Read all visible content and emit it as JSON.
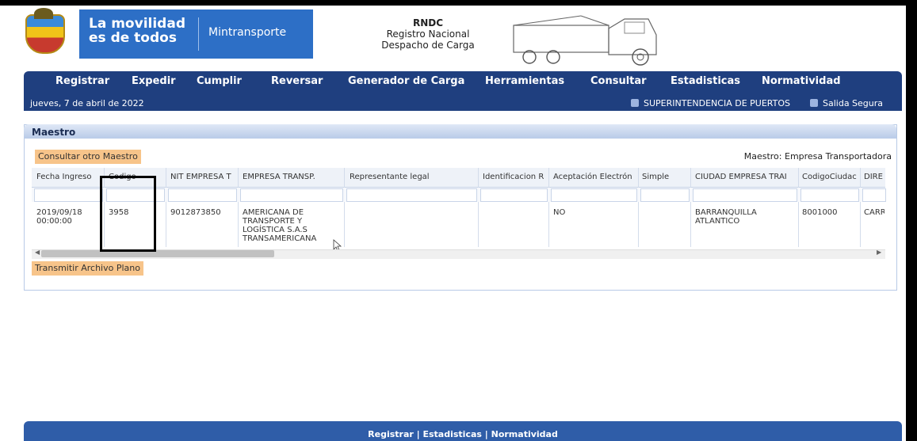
{
  "header": {
    "slogan_line1": "La movilidad",
    "slogan_line2": "es de todos",
    "ministry": "Mintransporte",
    "rndc_title": "RNDC",
    "rndc_line2": "Registro   Nacional",
    "rndc_line3": "Despacho de Carga",
    "brand_blue": "#2d6fc6"
  },
  "nav": {
    "items": [
      "Registrar",
      "Expedir",
      "Cumplir",
      "Reversar",
      "Generador de Carga",
      "Herramientas",
      "Consultar",
      "Estadisticas",
      "Normatividad"
    ],
    "bg_color": "#1f3f7f"
  },
  "subbar": {
    "date": "jueves, 7 de abril de 2022",
    "link_ports": "SUPERINTENDENCIA DE PUERTOS",
    "link_exit": "Salida Segura"
  },
  "panel": {
    "title": "Maestro",
    "consult_button": "Consultar otro Maestro",
    "maestro_label": "Maestro: Empresa Transportadora",
    "transmit_button": "Transmitir Archivo Plano",
    "button_color": "#f7c48a"
  },
  "table": {
    "columns": [
      "Fecha Ingreso",
      "Codigo",
      "NIT EMPRESA T",
      "EMPRESA TRANSP.",
      "Representante legal",
      "Identificacion R",
      "Aceptación Electrón",
      "Simple",
      "CIUDAD EMPRESA TRAI",
      "CodigoCiudac",
      "DIRE"
    ],
    "row": {
      "fecha": "2019/09/18",
      "hora": "00:00:00",
      "codigo": "3958",
      "nit": "9012873850",
      "empresa_l1": "AMERICANA DE",
      "empresa_l2": "TRANSPORTE Y",
      "empresa_l3": "LOGÍSTICA S.A.S",
      "empresa_l4": "TRANSAMERICANA",
      "representante": "",
      "identificacion": "",
      "aceptacion": "NO",
      "simple": "",
      "ciudad_l1": "BARRANQUILLA",
      "ciudad_l2": "ATLANTICO",
      "codigo_ciudad": "8001000",
      "direccion": "CARR"
    }
  },
  "footer": {
    "text": "Registrar  |  Estadisticas  |  Normatividad"
  }
}
